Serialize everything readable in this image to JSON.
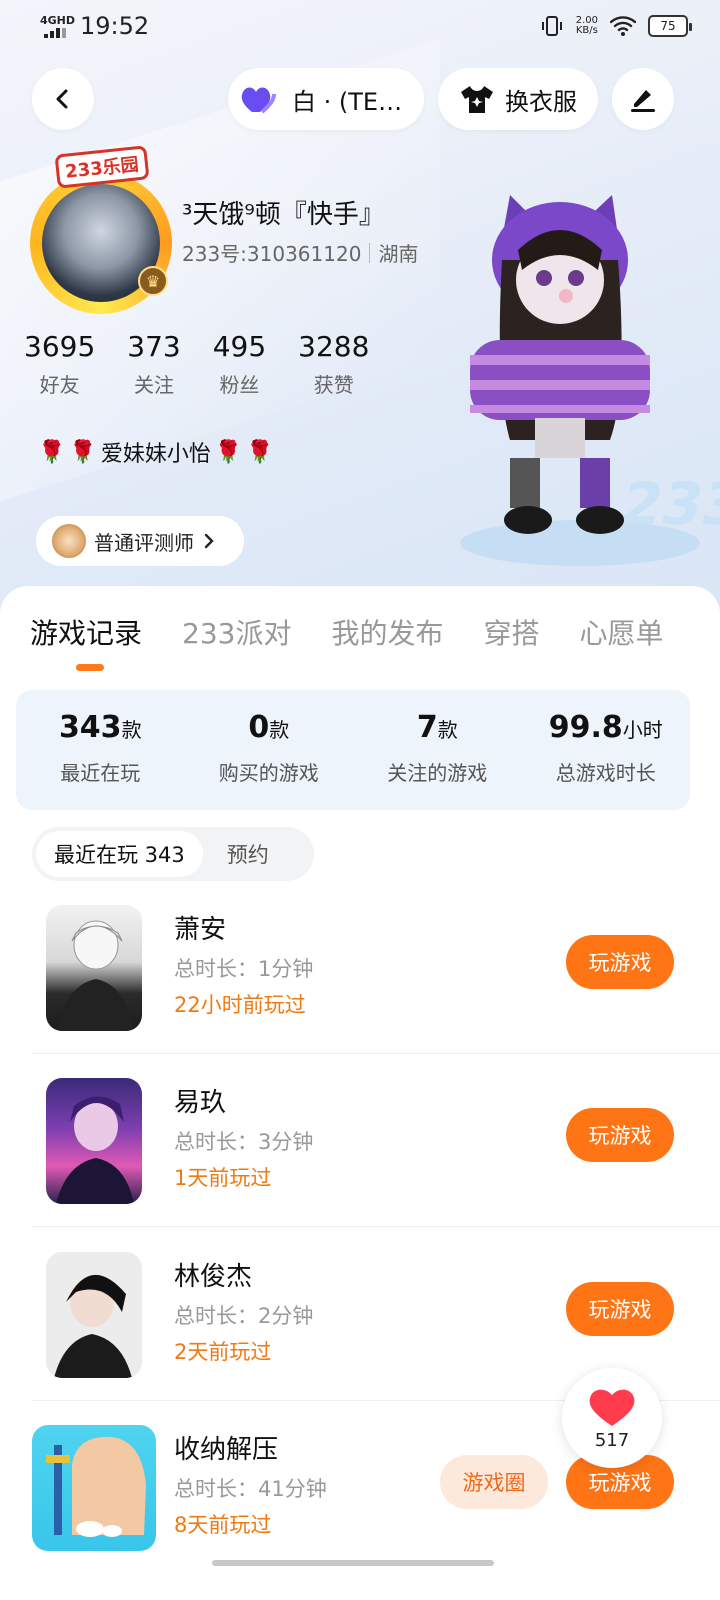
{
  "status_bar": {
    "network": "4GHD",
    "time": "19:52",
    "speed_value": "2.00",
    "speed_unit": "KB/s",
    "battery": "75"
  },
  "nav": {
    "theme_label": "白 · (TE…",
    "outfit_label": "换衣服"
  },
  "profile": {
    "avatar_tag": "233乐园",
    "username": "³天饿⁹顿『快手』",
    "id_text": "233号:310361120",
    "region": "湖南",
    "stats": [
      {
        "value": "3695",
        "label": "好友"
      },
      {
        "value": "373",
        "label": "关注"
      },
      {
        "value": "495",
        "label": "粉丝"
      },
      {
        "value": "3288",
        "label": "获赞"
      }
    ],
    "bio": "爱妹妹小怡",
    "badge": "普通评测师",
    "watermark": "233"
  },
  "tabs": [
    "游戏记录",
    "233派对",
    "我的发布",
    "穿搭",
    "心愿单"
  ],
  "summary": [
    {
      "value": "343",
      "unit": "款",
      "label": "最近在玩"
    },
    {
      "value": "0",
      "unit": "款",
      "label": "购买的游戏"
    },
    {
      "value": "7",
      "unit": "款",
      "label": "关注的游戏"
    },
    {
      "value": "99.8",
      "unit": "小时",
      "label": "总游戏时长"
    }
  ],
  "subtabs": {
    "active": "最近在玩 343",
    "other": "预约"
  },
  "games": [
    {
      "name": "萧安",
      "duration": "总时长：1分钟",
      "last": "22小时前玩过",
      "action": "玩游戏"
    },
    {
      "name": "易玖",
      "duration": "总时长：3分钟",
      "last": "1天前玩过",
      "action": "玩游戏"
    },
    {
      "name": "林俊杰",
      "duration": "总时长：2分钟",
      "last": "2天前玩过",
      "action": "玩游戏"
    },
    {
      "name": "收纳解压",
      "duration": "总时长：41分钟",
      "last": "8天前玩过",
      "action": "玩游戏",
      "circle": "游戏圈"
    }
  ],
  "like_count": "517",
  "colors": {
    "accent": "#ff7414",
    "orange_text": "#f07a12",
    "summary_bg": "#eef4fc"
  }
}
